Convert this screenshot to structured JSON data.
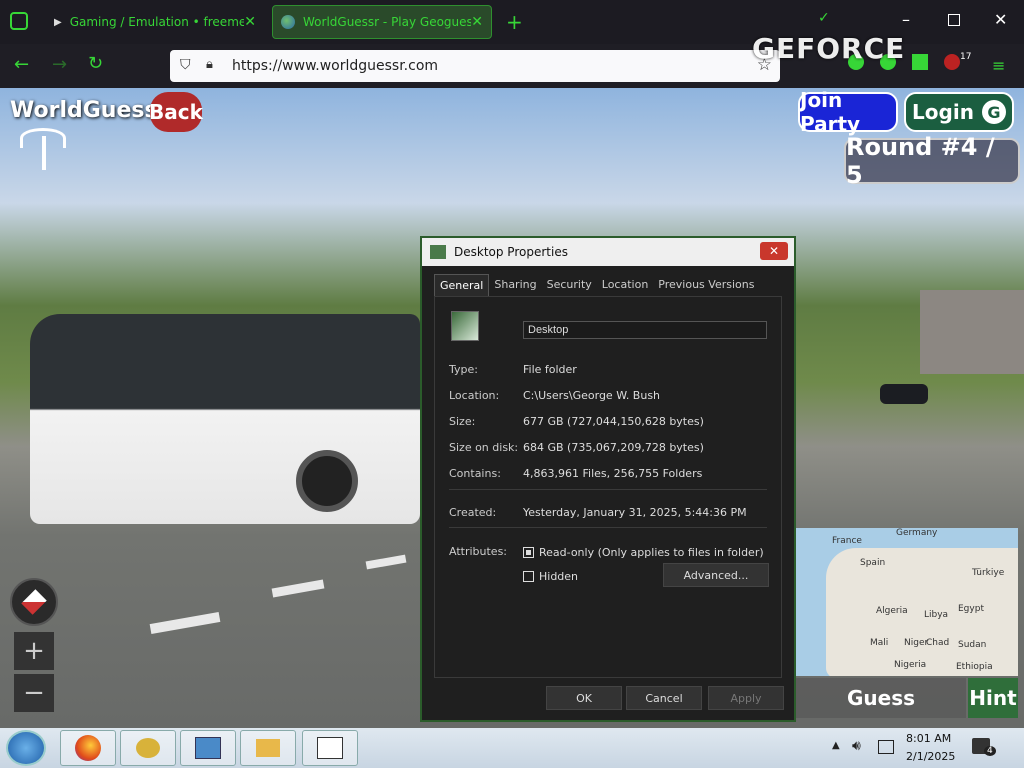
{
  "browser": {
    "tabs": [
      {
        "label": "Gaming / Emulation • freemedi"
      },
      {
        "label": "WorldGuessr - Play Geoguessr f"
      }
    ],
    "url": "https://www.worldguessr.com",
    "notification_count": "17",
    "overlay_logo": "GEFORCE"
  },
  "game": {
    "brand": "WorldGuessr",
    "back_label": "Back",
    "join_party_label": "Join Party",
    "login_label": "Login",
    "round_label": "Round #4 / 5",
    "guess_label": "Guess",
    "hint_label": "Hint",
    "map_labels": [
      "Germany",
      "France",
      "Spain",
      "Türkiye",
      "Algeria",
      "Libya",
      "Egypt",
      "Mali",
      "Niger",
      "Chad",
      "Sudan",
      "Nigeria",
      "Ethiopia"
    ]
  },
  "dialog": {
    "title": "Desktop Properties",
    "tabs": [
      "General",
      "Sharing",
      "Security",
      "Location",
      "Previous Versions"
    ],
    "name_value": "Desktop",
    "rows": [
      {
        "label": "Type:",
        "value": "File folder"
      },
      {
        "label": "Location:",
        "value": "C:\\Users\\George W. Bush"
      },
      {
        "label": "Size:",
        "value": "677 GB (727,044,150,628 bytes)"
      },
      {
        "label": "Size on disk:",
        "value": "684 GB (735,067,209,728 bytes)"
      },
      {
        "label": "Contains:",
        "value": "4,863,961 Files, 256,755 Folders"
      },
      {
        "label": "Created:",
        "value": "Yesterday, January 31, 2025, 5:44:36 PM"
      }
    ],
    "attributes_label": "Attributes:",
    "readonly_label": "Read-only (Only applies to files in folder)",
    "hidden_label": "Hidden",
    "advanced_label": "Advanced...",
    "ok_label": "OK",
    "cancel_label": "Cancel",
    "apply_label": "Apply"
  },
  "taskbar": {
    "time": "8:01 AM",
    "date": "2/1/2025",
    "notification_count": "4"
  }
}
